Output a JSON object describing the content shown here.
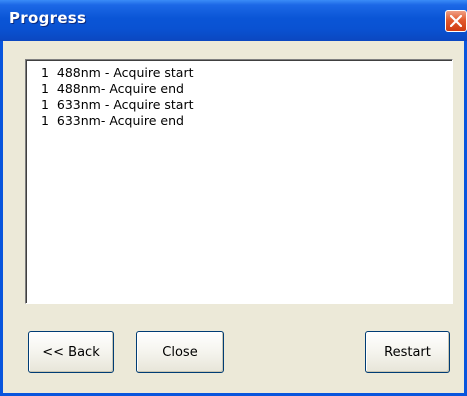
{
  "window": {
    "title": "Progress"
  },
  "log": {
    "lines": [
      "1  488nm - Acquire start",
      "1  488nm- Acquire end",
      "1  633nm - Acquire start",
      "1  633nm- Acquire end"
    ]
  },
  "buttons": {
    "back_label": "<< Back",
    "close_label": "Close",
    "restart_label": "Restart"
  },
  "icons": {
    "title_close": "close-icon"
  },
  "colors": {
    "titlebar": "#0a55d6",
    "close_button": "#e25a2e",
    "dialog_background": "#ece9d8"
  }
}
